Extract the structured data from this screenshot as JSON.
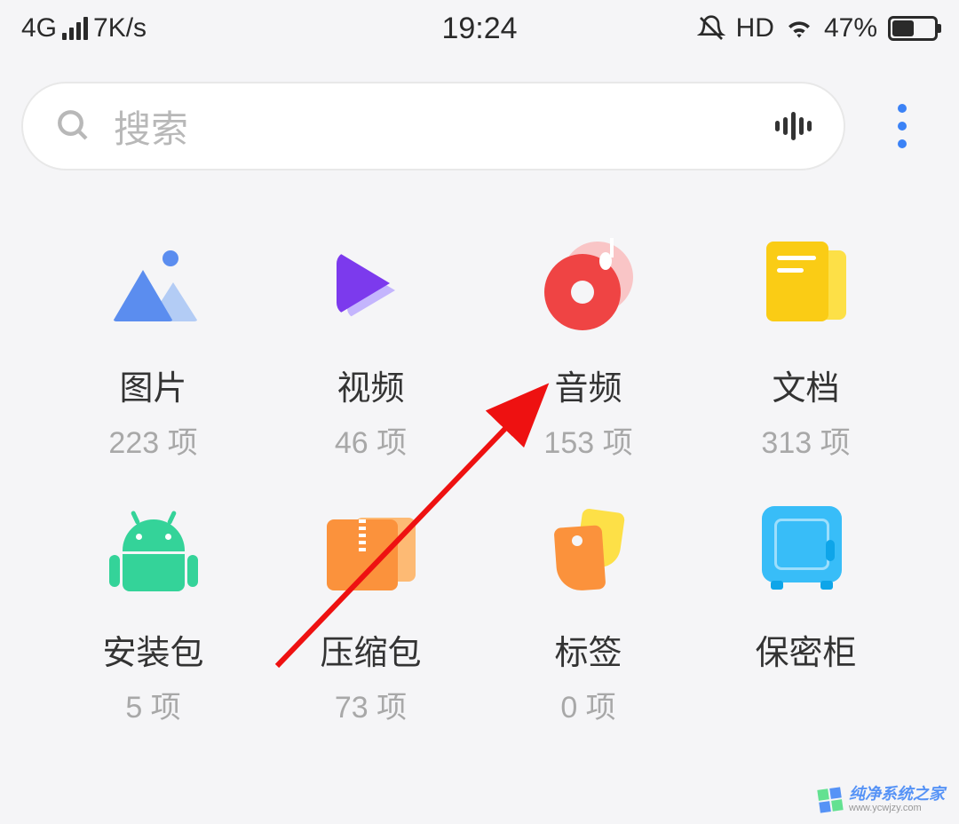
{
  "statusBar": {
    "network": "4G",
    "speed": "7K/s",
    "time": "19:24",
    "hd": "HD",
    "battery": "47%"
  },
  "search": {
    "placeholder": "搜索"
  },
  "categories": [
    {
      "label": "图片",
      "count": "223 项"
    },
    {
      "label": "视频",
      "count": "46 项"
    },
    {
      "label": "音频",
      "count": "153 项"
    },
    {
      "label": "文档",
      "count": "313 项"
    },
    {
      "label": "安装包",
      "count": "5 项"
    },
    {
      "label": "压缩包",
      "count": "73 项"
    },
    {
      "label": "标签",
      "count": "0 项"
    },
    {
      "label": "保密柜",
      "count": ""
    }
  ],
  "watermark": {
    "title": "纯净系统之家",
    "url": "www.ycwjzy.com"
  }
}
